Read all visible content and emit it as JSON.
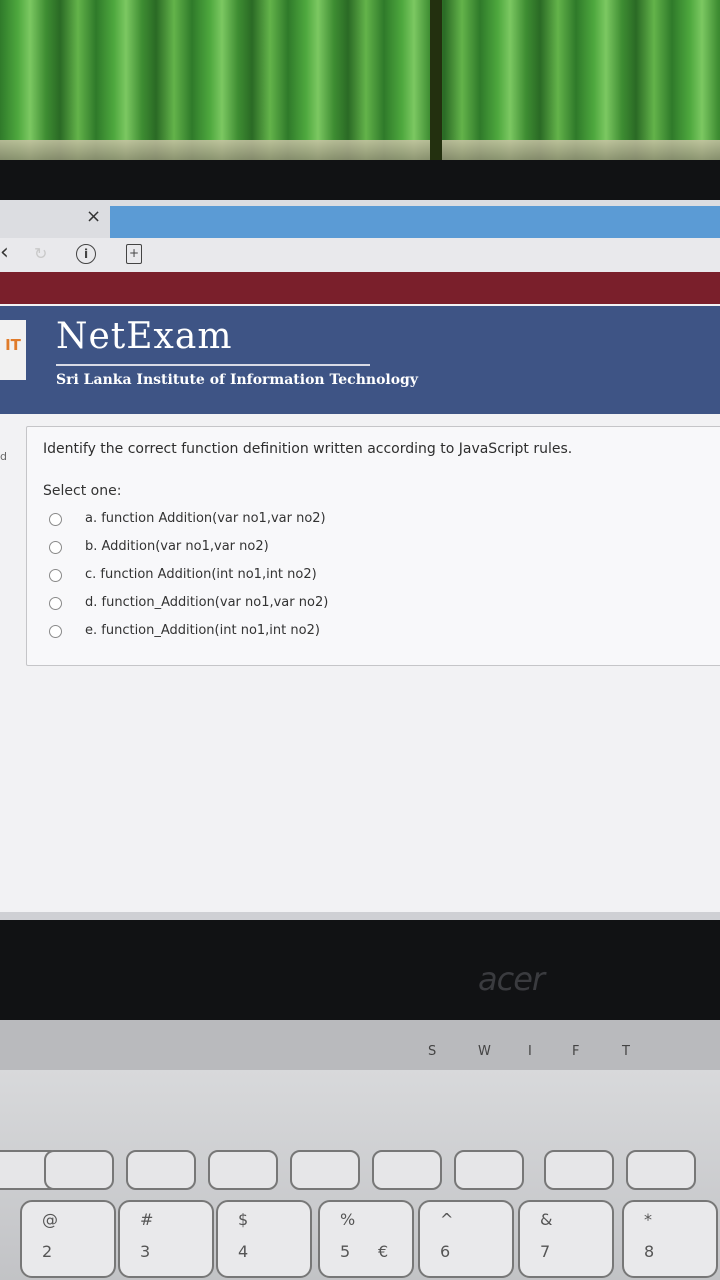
{
  "browser": {
    "close_tab_icon": "×",
    "back_icon": "‹",
    "reload_icon": "↻",
    "info_icon": "i",
    "add_page_icon": "+"
  },
  "site": {
    "logo_text": "IT",
    "title": "NetExam",
    "subtitle": "Sri Lanka Institute of Information Technology"
  },
  "quiz": {
    "side_marker": "d",
    "question": "Identify the correct function definition written according to JavaScript rules.",
    "select_label": "Select one:",
    "options": [
      {
        "label": "a. function Addition(var no1,var no2)"
      },
      {
        "label": "b. Addition(var no1,var no2)"
      },
      {
        "label": "c. function Addition(int no1,int no2)"
      },
      {
        "label": "d. function_Addition(var no1,var no2)"
      },
      {
        "label": "e. function_Addition(int no1,int no2)"
      }
    ]
  },
  "laptop": {
    "brand": "acer",
    "hinge_labels": [
      "S",
      "W",
      "I",
      "F",
      "T"
    ],
    "keys": [
      {
        "top": "@",
        "bottom": "2"
      },
      {
        "top": "#",
        "bottom": "3"
      },
      {
        "top": "$",
        "bottom": "4"
      },
      {
        "top": "%",
        "bottom": "5",
        "extra": "€"
      },
      {
        "top": "^",
        "bottom": "6"
      },
      {
        "top": "&",
        "bottom": "7"
      },
      {
        "top": "*",
        "bottom": "8"
      }
    ]
  }
}
